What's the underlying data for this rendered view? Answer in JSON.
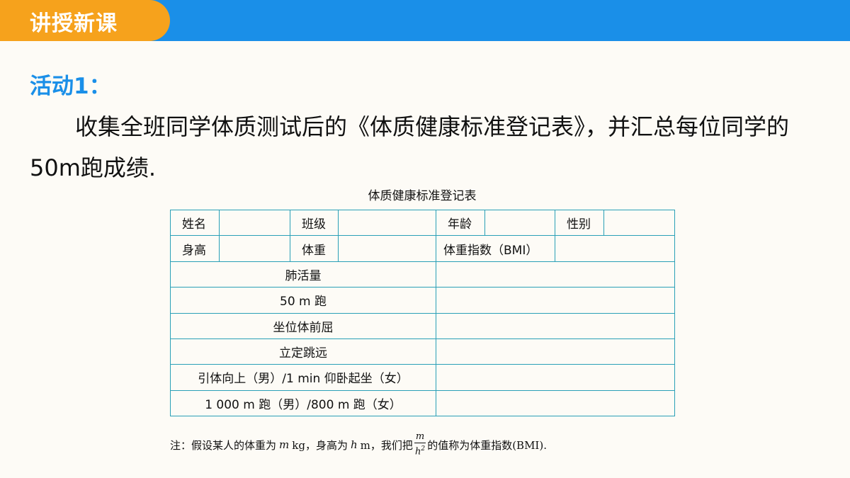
{
  "header": {
    "section_label": "讲授新课"
  },
  "activity": {
    "title": "活动1：",
    "body": "收集全班同学体质测试后的《体质健康标准登记表》，并汇总每位同学的50m跑成绩."
  },
  "table": {
    "title": "体质健康标准登记表",
    "row1": {
      "name_label": "姓名",
      "class_label": "班级",
      "age_label": "年龄",
      "gender_label": "性别"
    },
    "row2": {
      "height_label": "身高",
      "weight_label": "体重",
      "bmi_label": "体重指数（BMI）"
    },
    "items": [
      "肺活量",
      "50 m 跑",
      "坐位体前屈",
      "立定跳远",
      "引体向上（男）/1 min 仰卧起坐（女）",
      "1 000 m 跑（男）/800 m 跑（女）"
    ]
  },
  "note": {
    "prefix": "注：假设某人的体重为",
    "var_m": "m",
    "unit_kg": "kg，身高为",
    "var_h": "h",
    "unit_m": "m，我们把",
    "frac_num": "m",
    "frac_den": "h",
    "frac_exp": "2",
    "suffix": "的值称为体重指数(BMI)."
  }
}
